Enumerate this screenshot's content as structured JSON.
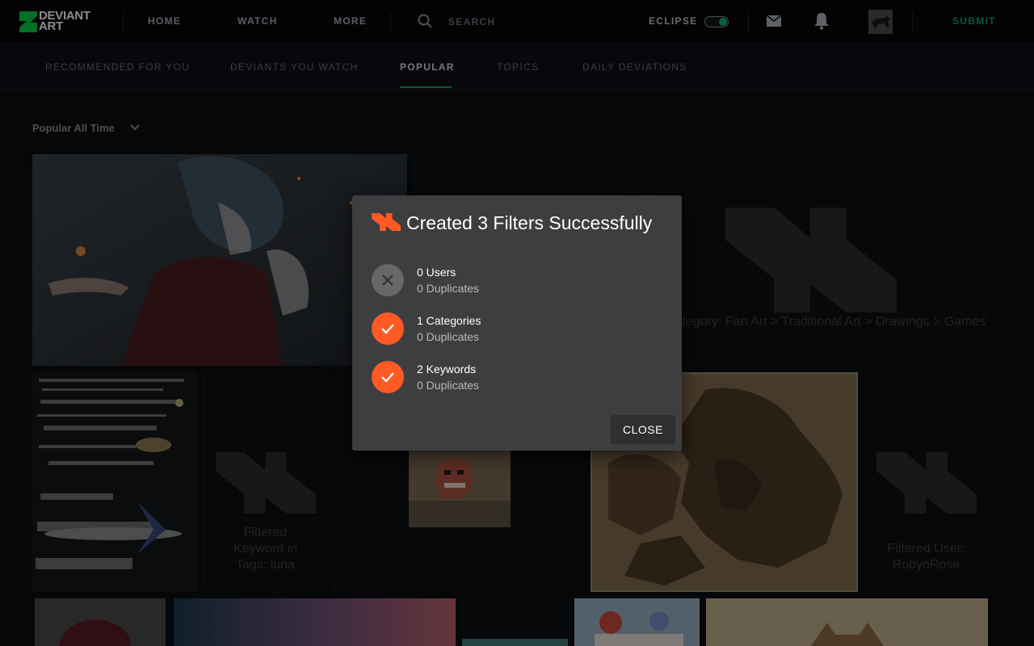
{
  "header": {
    "logo_text_line1": "DEVIANT",
    "logo_text_line2": "ART",
    "nav": [
      {
        "label": "HOME"
      },
      {
        "label": "WATCH"
      },
      {
        "label": "MORE"
      }
    ],
    "search_label": "SEARCH",
    "theme_label": "ECLIPSE",
    "theme_enabled": true,
    "submit_label": "SUBMIT",
    "brand_color": "#0fa36a"
  },
  "subnav": {
    "tabs": [
      {
        "label": "RECOMMENDED FOR YOU"
      },
      {
        "label": "DEVIANTS YOU WATCH"
      },
      {
        "label": "POPULAR"
      },
      {
        "label": "TOPICS"
      },
      {
        "label": "DAILY DEVIATIONS"
      }
    ],
    "active_tab": "POPULAR"
  },
  "feed": {
    "sort_label": "Popular All Time",
    "filtered_tiles": [
      {
        "text": "ered Category: Fan Art > Traditional Art > Drawings > Games"
      },
      {
        "text": "Filtered Keyword in Tags: luna"
      },
      {
        "text": "Filtered User: RobynRose"
      }
    ]
  },
  "modal": {
    "title": "Created 3 Filters Successfully",
    "accent_color": "#ff5a24",
    "results": [
      {
        "status": "none",
        "icon": "x-icon",
        "main": "0 Users",
        "sub": "0 Duplicates"
      },
      {
        "status": "success",
        "icon": "check-icon",
        "main": "1 Categories",
        "sub": "0 Duplicates"
      },
      {
        "status": "success",
        "icon": "check-icon",
        "main": "2 Keywords",
        "sub": "0 Duplicates"
      }
    ],
    "close_label": "CLOSE"
  }
}
